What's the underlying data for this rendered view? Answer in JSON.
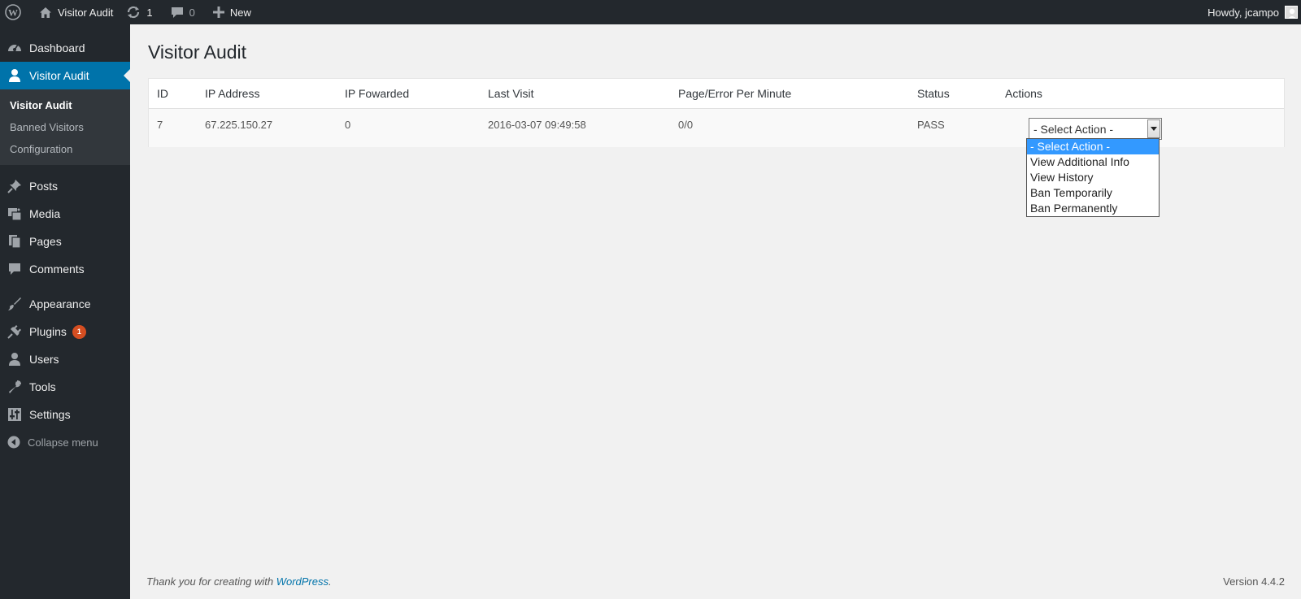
{
  "adminbar": {
    "site_name": "Visitor Audit",
    "updates_count": "1",
    "comments_count": "0",
    "new_label": "New",
    "howdy": "Howdy, jcampo"
  },
  "sidebar": {
    "items": [
      {
        "label": "Dashboard",
        "icon": "dashboard-icon"
      },
      {
        "label": "Visitor Audit",
        "icon": "user-icon"
      },
      {
        "label": "Posts",
        "icon": "pin-icon"
      },
      {
        "label": "Media",
        "icon": "media-icon"
      },
      {
        "label": "Pages",
        "icon": "pages-icon"
      },
      {
        "label": "Comments",
        "icon": "comment-icon"
      },
      {
        "label": "Appearance",
        "icon": "brush-icon"
      },
      {
        "label": "Plugins",
        "icon": "plug-icon",
        "badge": "1"
      },
      {
        "label": "Users",
        "icon": "users-icon"
      },
      {
        "label": "Tools",
        "icon": "wrench-icon"
      },
      {
        "label": "Settings",
        "icon": "sliders-icon"
      }
    ],
    "submenu": [
      "Visitor Audit",
      "Banned Visitors",
      "Configuration"
    ],
    "collapse_label": "Collapse menu"
  },
  "main": {
    "title": "Visitor Audit",
    "columns": [
      "ID",
      "IP Address",
      "IP Fowarded",
      "Last Visit",
      "Page/Error Per Minute",
      "Status",
      "Actions"
    ],
    "rows": [
      {
        "id": "7",
        "ip": "67.225.150.27",
        "forwarded": "0",
        "last_visit": "2016-03-07 09:49:58",
        "rate": "0/0",
        "status": "PASS",
        "action": "- Select Action -"
      }
    ],
    "action_options": [
      "- Select Action -",
      "View Additional Info",
      "View History",
      "Ban Temporarily",
      "Ban Permanently"
    ]
  },
  "footer": {
    "thanks_prefix": "Thank you for creating with ",
    "thanks_link": "WordPress",
    "thanks_suffix": ".",
    "version": "Version 4.4.2"
  },
  "colors": {
    "accent": "#0073aa",
    "bar": "#23282d",
    "badge": "#d54e21",
    "option_highlight": "#3399ff"
  }
}
